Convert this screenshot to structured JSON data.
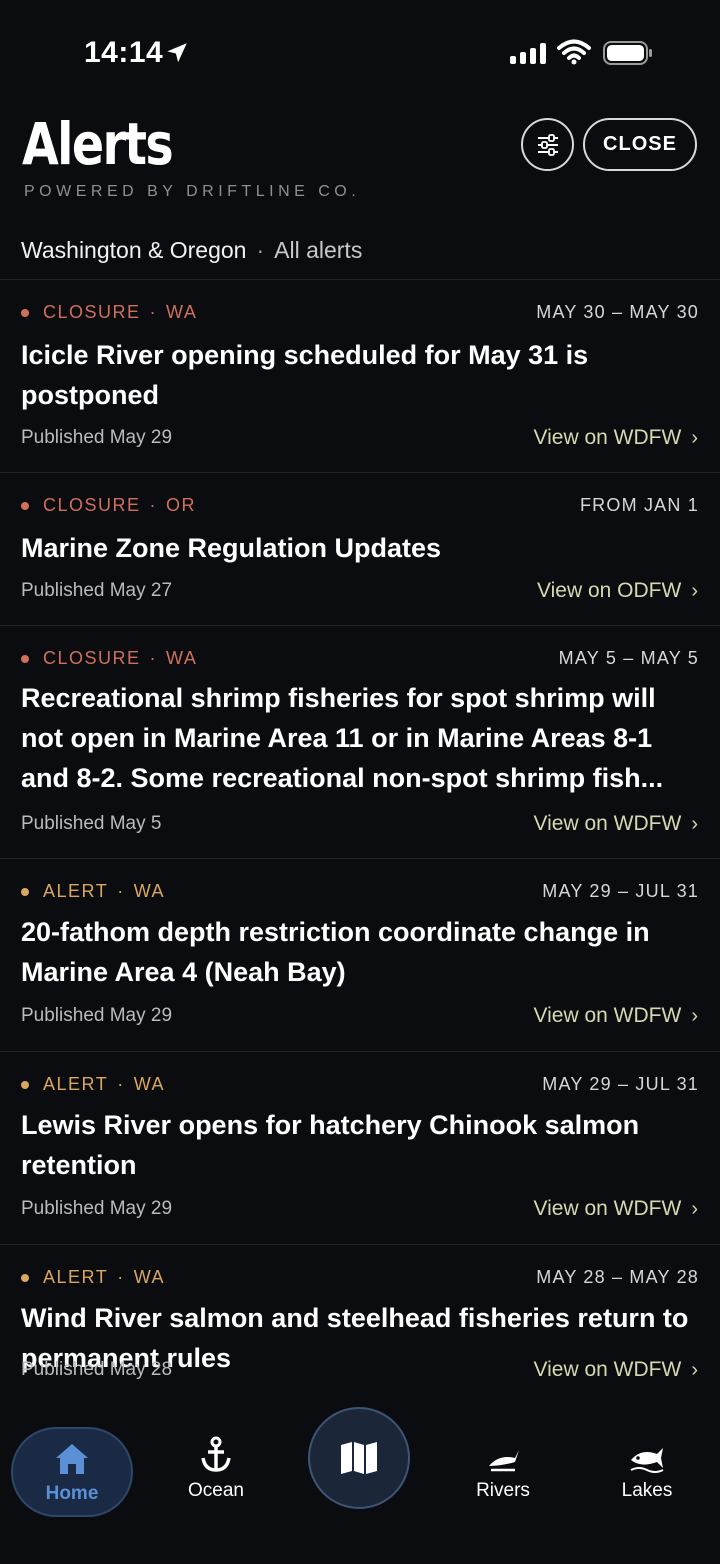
{
  "status_bar": {
    "time": "14:14"
  },
  "header": {
    "title": "Alerts",
    "subtitle": "POWERED BY DRIFTLINE CO.",
    "close_label": "CLOSE",
    "filter_icon": "sliders-icon"
  },
  "region": {
    "label": "Washington & Oregon",
    "separator": "·",
    "scope": "All alerts"
  },
  "alerts": [
    {
      "type": "CLOSURE",
      "state": "WA",
      "date_range": "MAY 30 – MAY 30",
      "title": "Icicle River opening scheduled for May 31 is postponed",
      "published": "Published May 29",
      "link": "View on WDFW"
    },
    {
      "type": "CLOSURE",
      "state": "OR",
      "date_range": "FROM JAN 1",
      "title": "Marine Zone Regulation Updates",
      "published": "Published May 27",
      "link": "View on ODFW"
    },
    {
      "type": "CLOSURE",
      "state": "WA",
      "date_range": "MAY 5 – MAY 5",
      "title": "Recreational shrimp fisheries for spot shrimp will not open in Marine Area 11 or in Marine Areas 8-1 and 8-2. Some recreational non-spot shrimp fish...",
      "published": "Published May 5",
      "link": "View on WDFW"
    },
    {
      "type": "ALERT",
      "state": "WA",
      "date_range": "MAY 29 – JUL 31",
      "title": "20-fathom depth restriction coordinate change in Marine Area 4 (Neah Bay)",
      "published": "Published May 29",
      "link": "View on WDFW"
    },
    {
      "type": "ALERT",
      "state": "WA",
      "date_range": "MAY 29 – JUL 31",
      "title": "Lewis River opens for hatchery Chinook salmon retention",
      "published": "Published May 29",
      "link": "View on WDFW"
    },
    {
      "type": "ALERT",
      "state": "WA",
      "date_range": "MAY 28 – MAY 28",
      "title": "Wind River salmon and steelhead fisheries return to permanent rules",
      "published": "Published May 28",
      "link": "View on WDFW"
    }
  ],
  "tabs": {
    "home": {
      "label": "Home",
      "icon": "house-icon"
    },
    "ocean": {
      "label": "Ocean",
      "icon": "anchor-icon"
    },
    "map": {
      "icon": "map-icon"
    },
    "rivers": {
      "label": "Rivers",
      "icon": "fish-icon"
    },
    "lakes": {
      "label": "Lakes",
      "icon": "lake-fish-icon"
    }
  },
  "colors": {
    "background": "#0b0c10",
    "closure": "#d0705a",
    "alert": "#d9a760",
    "link": "#d6d8b0",
    "home_active": "#5b8fd6"
  }
}
